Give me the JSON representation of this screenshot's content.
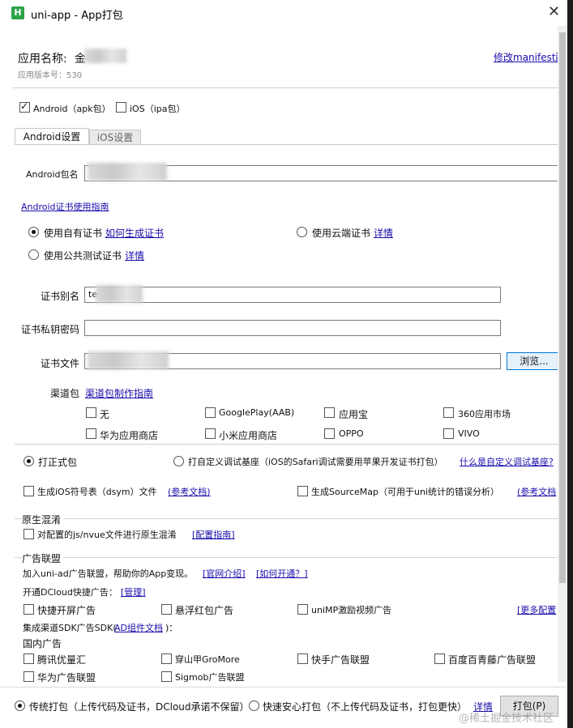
{
  "window": {
    "title": "uni-app - App打包",
    "app_icon": "H",
    "close_glyph": "✕"
  },
  "header": {
    "app_name_label": "应用名称:",
    "app_name_partial": "金",
    "version_label": "应用版本号：530",
    "edit_manifest_link": "修改manifest配"
  },
  "platforms": {
    "android_label": "Android（apk包）",
    "android_checked": true,
    "ios_label": "iOS（ipa包）",
    "ios_checked": false
  },
  "tabs": [
    {
      "label": "Android设置",
      "active": true
    },
    {
      "label": "iOS设置",
      "active": false
    }
  ],
  "android": {
    "package_label": "Android包名",
    "cert_guide_link": "Android证书使用指南",
    "cert_options": {
      "own_cert_label": "使用自有证书",
      "own_cert_link": "如何生成证书",
      "cloud_cert_label": "使用云端证书",
      "cloud_cert_link": "详情",
      "public_cert_label": "使用公共测试证书",
      "public_cert_link": "详情"
    },
    "alias_label": "证书别名",
    "alias_value": "te",
    "password_label": "证书私钥密码",
    "file_label": "证书文件",
    "browse_button": "浏览...",
    "channel_label": "渠道包",
    "channel_guide_link": "渠道包制作指南",
    "channels": [
      {
        "label": "无",
        "checked": false
      },
      {
        "label": "GooglePlay(AAB)",
        "checked": false
      },
      {
        "label": "应用宝",
        "checked": false
      },
      {
        "label": "360应用市场",
        "checked": false
      },
      {
        "label": "华为应用商店",
        "checked": false
      },
      {
        "label": "小米应用商店",
        "checked": false
      },
      {
        "label": "OPPO",
        "checked": false
      },
      {
        "label": "VIVO",
        "checked": false
      }
    ]
  },
  "build_type": {
    "formal_label": "打正式包",
    "custom_label": "打自定义调试基座（iOS的Safari调试需要用苹果开发证书打包）",
    "custom_link": "什么是自定义调试基座?"
  },
  "symbols": {
    "dsym_label": "生成iOS符号表（dsym）文件",
    "dsym_link": "(参考文档)",
    "sourcemap_label": "生成SourceMap（可用于uni统计的错误分析）",
    "sourcemap_link": "(参考文档"
  },
  "obfuscation": {
    "title": "原生混淆",
    "option_label": "对配置的js/nvue文件进行原生混淆",
    "option_link": "[配置指南]"
  },
  "ads": {
    "title": "广告联盟",
    "intro": "加入uni-ad广告联盟，帮助你的App变现。",
    "intro_link1": "[官网介绍]",
    "intro_link2": "[如何开通？]",
    "dcloud_label": "开通DCloud快捷广告：",
    "dcloud_link": "[管理]",
    "quick_ads": [
      {
        "label": "快捷开屏广告",
        "checked": false
      },
      {
        "label": "悬浮红包广告",
        "checked": false
      },
      {
        "label": "uniMP激励视频广告",
        "checked": false
      }
    ],
    "more_config_link": "[更多配置",
    "sdk_label_prefix": "集成渠道SDK广告SDK(",
    "sdk_label_link": "AD组件文档",
    "sdk_label_suffix": ")：",
    "domestic_label": "国内广告",
    "domestic_ads": [
      {
        "label": "腾讯优量汇",
        "checked": false
      },
      {
        "label": "穿山甲GroMore",
        "checked": false
      },
      {
        "label": "快手广告联盟",
        "checked": false
      },
      {
        "label": "百度百青藤广告联盟",
        "checked": false
      },
      {
        "label": "华为广告联盟",
        "checked": false
      },
      {
        "label": "Sigmob广告联盟",
        "checked": false
      }
    ]
  },
  "footer": {
    "traditional_label": "传统打包（上传代码及证书，DCloud承诺不保留）",
    "traditional_checked": true,
    "fast_label": "快速安心打包（不上传代码及证书，打包更快）",
    "fast_checked": false,
    "details_link": "详情",
    "pack_button": "打包(P)",
    "watermark": "@稀土掘金技术社区"
  }
}
